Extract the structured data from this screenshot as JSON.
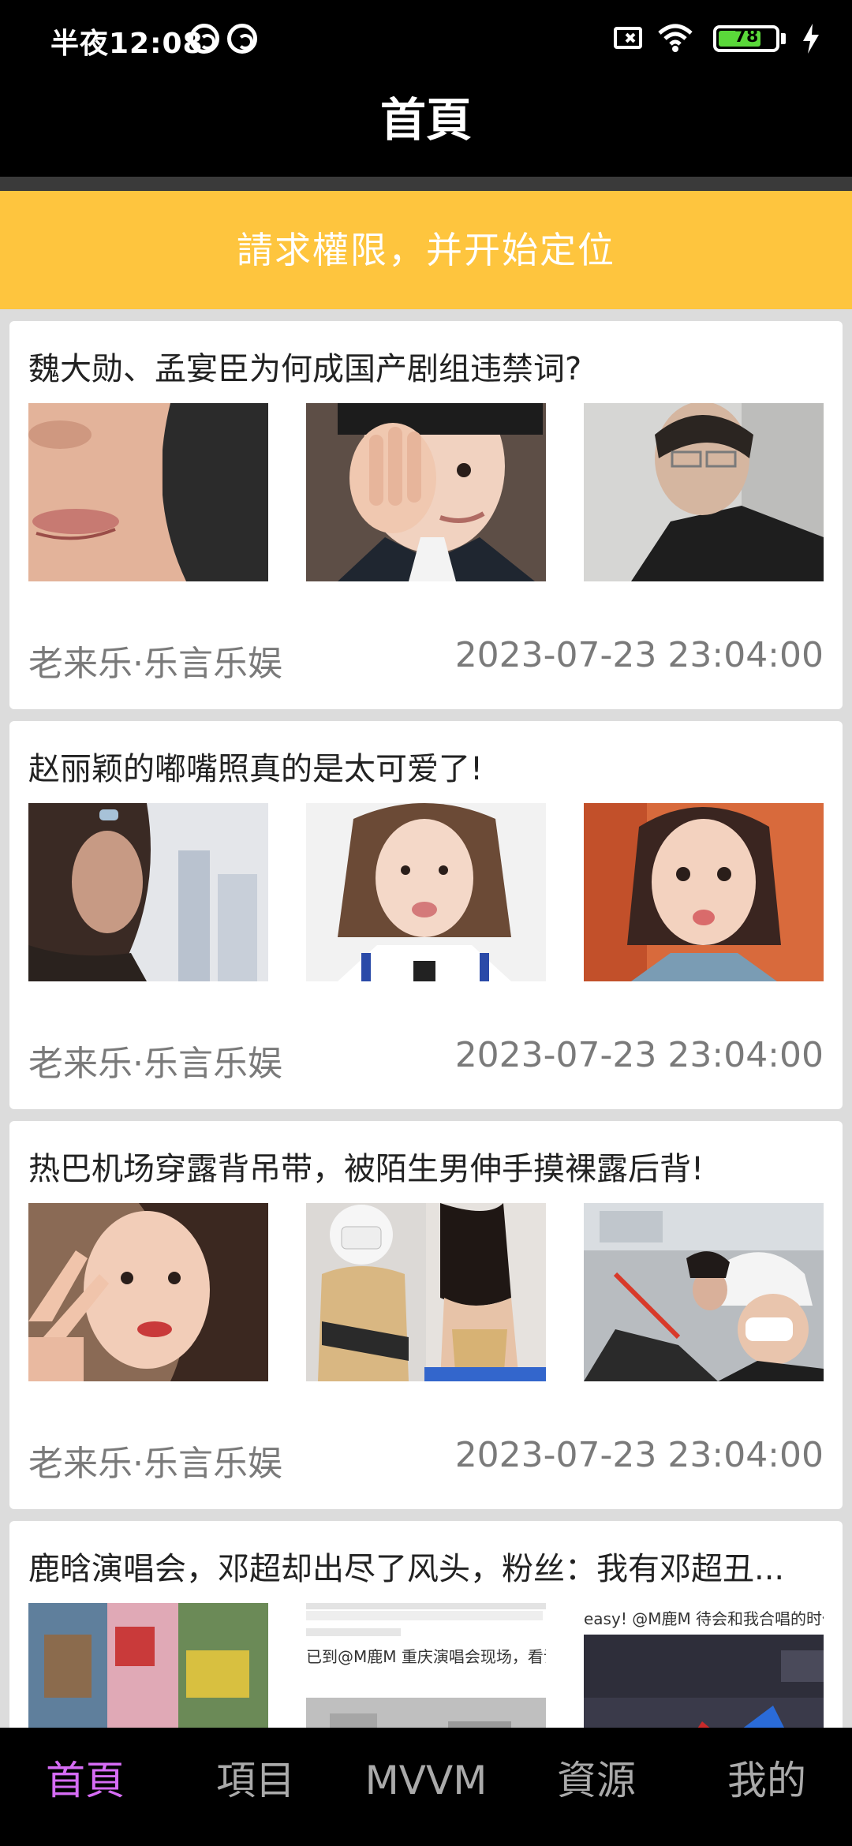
{
  "status_bar": {
    "time": "半夜12:08",
    "battery_level": "78",
    "battery_fraction": 0.78,
    "icons": [
      "notification-icon",
      "notification-icon",
      "no-sim-icon",
      "wifi-icon",
      "battery-icon",
      "charging-icon"
    ]
  },
  "app_bar": {
    "title": "首頁"
  },
  "location_banner": {
    "text": "請求權限，并开始定位"
  },
  "colors": {
    "bar_background": "#000000",
    "banner_background": "#fec53e",
    "active_tab": "#d66cf5",
    "inactive_tab": "#aaaaaa",
    "meta_text": "#7a7a7a"
  },
  "feed": [
    {
      "title": "魏大勋、孟宴臣为何成国产剧组违禁词?",
      "source": "老来乐·乐言乐娱",
      "time": "2023-07-23 23:04:00",
      "images": [
        "photo-closeup-face",
        "photo-man-hand-over-eye",
        "photo-man-glasses-dark"
      ]
    },
    {
      "title": "赵丽颖的嘟嘴照真的是太可爱了!",
      "source": "老来乐·乐言乐娱",
      "time": "2023-07-23 23:04:00",
      "images": [
        "photo-woman-profile",
        "photo-woman-pout-bob",
        "photo-woman-pout-orange"
      ]
    },
    {
      "title": "热巴机场穿露背吊带，被陌生男伸手摸裸露后背!",
      "source": "老来乐·乐言乐娱",
      "time": "2023-07-23 23:04:00",
      "images": [
        "photo-woman-peace-sign",
        "photo-airport-outfit",
        "photo-airport-crowd"
      ]
    },
    {
      "title": "鹿晗演唱会，邓超却出尽了风头，粉丝：我有邓超丑...",
      "source": "",
      "time": "",
      "images": [
        "photo-colorful-jacket",
        "photo-weibo-screenshot",
        "photo-concert-stage"
      ],
      "image_captions": [
        "已到@M鹿M 重庆演唱会现场，看谁今晚讠",
        "easy! @M鹿M 待会和我合唱的时候别"
      ]
    }
  ],
  "bottom_nav": {
    "items": [
      "首頁",
      "項目",
      "MVVM",
      "資源",
      "我的"
    ],
    "active_index": 0
  }
}
